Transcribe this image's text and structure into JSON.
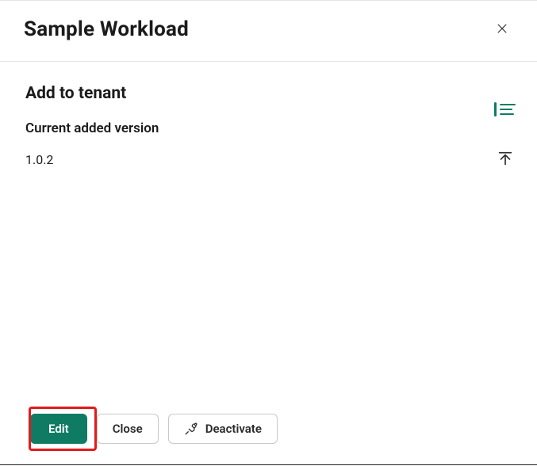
{
  "header": {
    "title": "Sample Workload",
    "close_label": "Close"
  },
  "body": {
    "section_title": "Add to tenant",
    "version_heading": "Current added version",
    "version_value": "1.0.2"
  },
  "footer": {
    "edit_label": "Edit",
    "close_label": "Close",
    "deactivate_label": "Deactivate"
  },
  "colors": {
    "accent": "#0f7b63",
    "highlight": "#e11a1a"
  }
}
